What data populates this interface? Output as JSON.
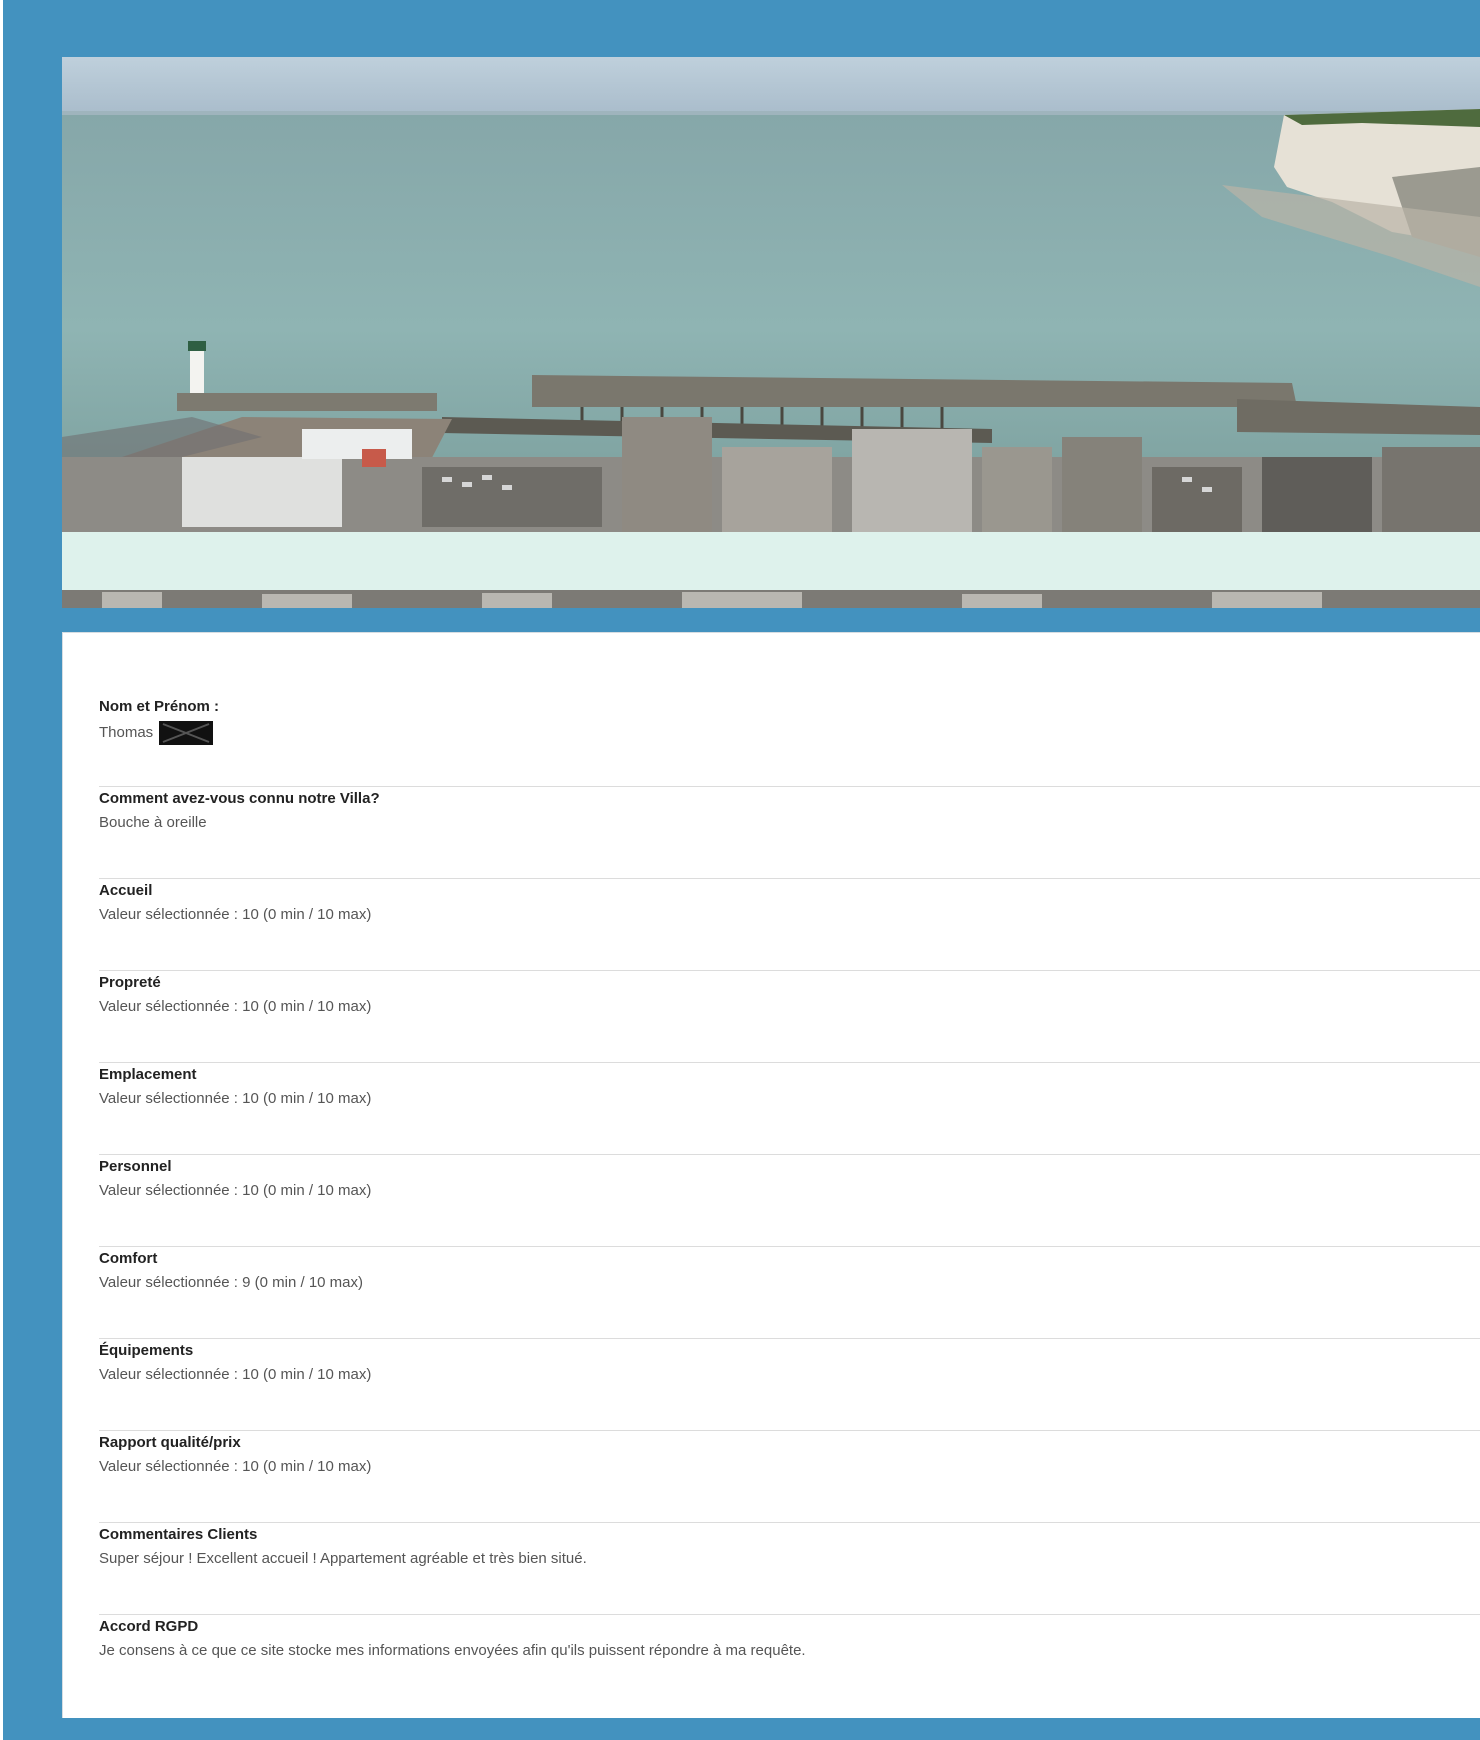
{
  "colors": {
    "page_background": "#4392bf",
    "band": "#def2ec",
    "card": "#ffffff",
    "label_text": "#222222",
    "value_text": "#555555"
  },
  "header": {
    "image": "coastal-harbor-photo"
  },
  "form_entries": [
    {
      "label": "Nom et Prénom :",
      "value": "Thomas",
      "redacted": true
    },
    {
      "label": "Comment avez-vous connu notre Villa?",
      "value": "Bouche à oreille"
    },
    {
      "label": "Accueil",
      "value": "Valeur sélectionnée : 10 (0 min / 10 max)"
    },
    {
      "label": "Propreté",
      "value": "Valeur sélectionnée : 10 (0 min / 10 max)"
    },
    {
      "label": "Emplacement",
      "value": "Valeur sélectionnée : 10 (0 min / 10 max)"
    },
    {
      "label": "Personnel",
      "value": "Valeur sélectionnée : 10 (0 min / 10 max)"
    },
    {
      "label": "Comfort",
      "value": "Valeur sélectionnée : 9 (0 min / 10 max)"
    },
    {
      "label": "Équipements",
      "value": "Valeur sélectionnée : 10 (0 min / 10 max)"
    },
    {
      "label": "Rapport qualité/prix",
      "value": "Valeur sélectionnée : 10 (0 min / 10 max)"
    },
    {
      "label": "Commentaires Clients",
      "value": "Super séjour ! Excellent accueil ! Appartement agréable et très bien situé."
    },
    {
      "label": "Accord RGPD",
      "value": "Je consens à ce que ce site stocke mes informations envoyées afin qu'ils puissent répondre à ma requête."
    }
  ]
}
